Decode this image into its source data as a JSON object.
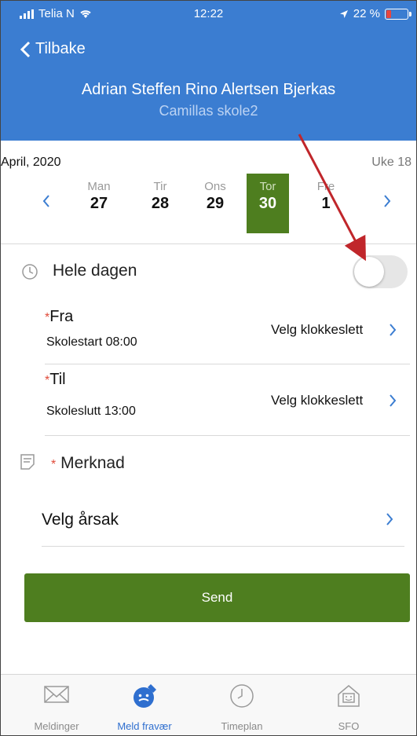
{
  "status": {
    "carrier": "Telia N",
    "time": "12:22",
    "battery": "22 %",
    "battery_level": 0.22
  },
  "header": {
    "back_label": "Tilbake",
    "name": "Adrian Steffen Rino Alertsen Bjerkas",
    "school": "Camillas skole2"
  },
  "calendar": {
    "month": "April, 2020",
    "week": "Uke 18",
    "days": [
      {
        "name": "Man",
        "date": "27"
      },
      {
        "name": "Tir",
        "date": "28"
      },
      {
        "name": "Ons",
        "date": "29"
      },
      {
        "name": "Tor",
        "date": "30",
        "selected": true
      },
      {
        "name": "Fre",
        "date": "1"
      }
    ]
  },
  "allday": {
    "label": "Hele dagen",
    "on": false
  },
  "from": {
    "required": "*",
    "label": "Fra",
    "sub": "Skolestart 08:00",
    "action": "Velg klokkeslett"
  },
  "to": {
    "required": "*",
    "label": "Til",
    "sub": "Skoleslutt 13:00",
    "action": "Velg klokkeslett"
  },
  "note": {
    "required": "*",
    "label": "Merknad"
  },
  "reason": {
    "label": "Velg årsak"
  },
  "send_label": "Send",
  "tabs": [
    {
      "label": "Meldinger",
      "icon": "mail-icon"
    },
    {
      "label": "Meld fravær",
      "icon": "report-absence-icon",
      "active": true
    },
    {
      "label": "Timeplan",
      "icon": "clock-icon"
    },
    {
      "label": "SFO",
      "icon": "house-icon"
    }
  ],
  "colors": {
    "header": "#3b7dd1",
    "accent_green": "#4e7e1f",
    "link_blue": "#2f6fcf",
    "arrow_red": "#c0262b"
  }
}
